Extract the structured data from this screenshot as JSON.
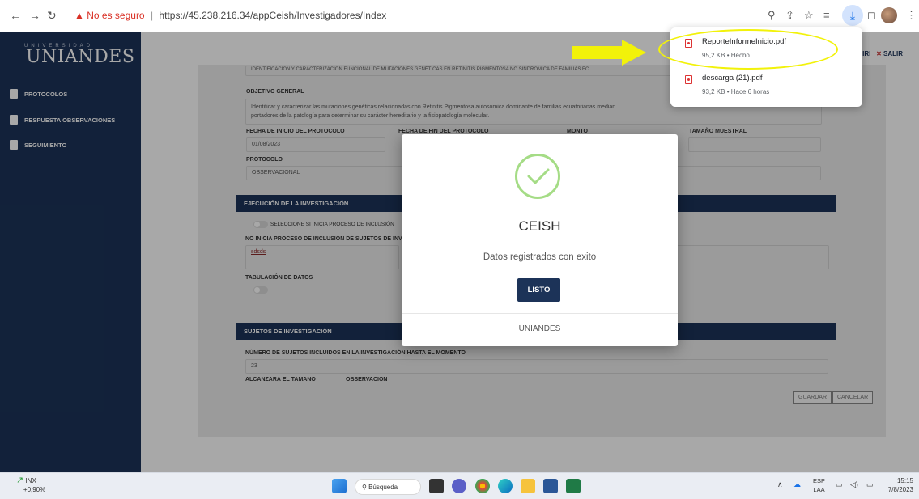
{
  "browser": {
    "security_label": "No es seguro",
    "url": "https://45.238.216.34/appCeish/Investigadores/Index"
  },
  "sidebar": {
    "logo_top": "UNIVERSIDAD",
    "logo": "UNIANDES",
    "items": [
      {
        "label": "PROTOCOLOS"
      },
      {
        "label": "RESPUESTA OBSERVACIONES"
      },
      {
        "label": "SEGUIMIENTO"
      }
    ]
  },
  "header": {
    "user_fragment": "IRI",
    "logout": "SALIR"
  },
  "form": {
    "title_strip": "IDENTIFICACIÓN Y CARACTERIZACIÓN FUNCIONAL DE MUTACIONES GENÉTICAS EN RETINITIS PIGMENTOSA NO SINDRÓMICA DE FAMILIAS EC",
    "objetivo_label": "OBJETIVO GENERAL",
    "objetivo_value_1": "Identificar y caracterizar las mutaciones genéticas relacionadas con Retinitis Pigmentosa autosómica dominante de familias ecuatorianas median",
    "objetivo_value_2": "portadores de la patología para determinar su carácter hereditario y la fisiopatología molecular.",
    "fecha_inicio_label": "FECHA DE INICIO DEL PROTOCOLO",
    "fecha_inicio_value": "01/08/2023",
    "fecha_fin_label": "FECHA DE FIN DEL PROTOCOLO",
    "monto_label": "MONTO",
    "tamano_label": "TAMAÑO MUESTRAL",
    "protocolo_label": "PROTOCOLO",
    "protocolo_value": "OBSERVACIONAL",
    "ejecucion_title": "EJECUCIÓN DE LA INVESTIGACIÓN",
    "toggle_inicio_label": "SELECCIONE SI INICIA PROCESO DE INCLUSIÓN",
    "no_inicia_label": "NO INICIA PROCESO DE INCLUSIÓN DE SUJETOS DE INV",
    "no_inicia_value": "sdsds",
    "tabulacion_label": "TABULACIÓN DE DATOS",
    "sujetos_title": "SUJETOS DE INVESTIGACIÓN",
    "numero_label": "NÚMERO DE SUJETOS INCLUIDOS EN LA INVESTIGACIÓN HASTA EL MOMENTO",
    "numero_value": "23",
    "alcanzara_label": "ALCANZARÁ EL TAMAÑO",
    "observacion_label": "OBSERVACION",
    "guardar": "GUARDAR",
    "cancelar": "CANCELAR"
  },
  "modal": {
    "title": "CEISH",
    "message": "Datos registrados con exito",
    "button": "LISTO",
    "footer": "UNIANDES"
  },
  "downloads": [
    {
      "name": "ReporteInformeInicio.pdf",
      "meta": "95,2 KB • Hecho"
    },
    {
      "name": "descarga (21).pdf",
      "meta": "93,2 KB • Hace 6 horas"
    }
  ],
  "taskbar": {
    "stock_name": "INX",
    "stock_change": "+0,90%",
    "search": "Búsqueda",
    "lang_1": "ESP",
    "lang_2": "LAA",
    "time": "15:15",
    "date": "7/8/2023"
  },
  "colors": {
    "navy": "#1c3358",
    "success_green": "#a5dc86",
    "annotation_yellow": "#f2f20a"
  }
}
